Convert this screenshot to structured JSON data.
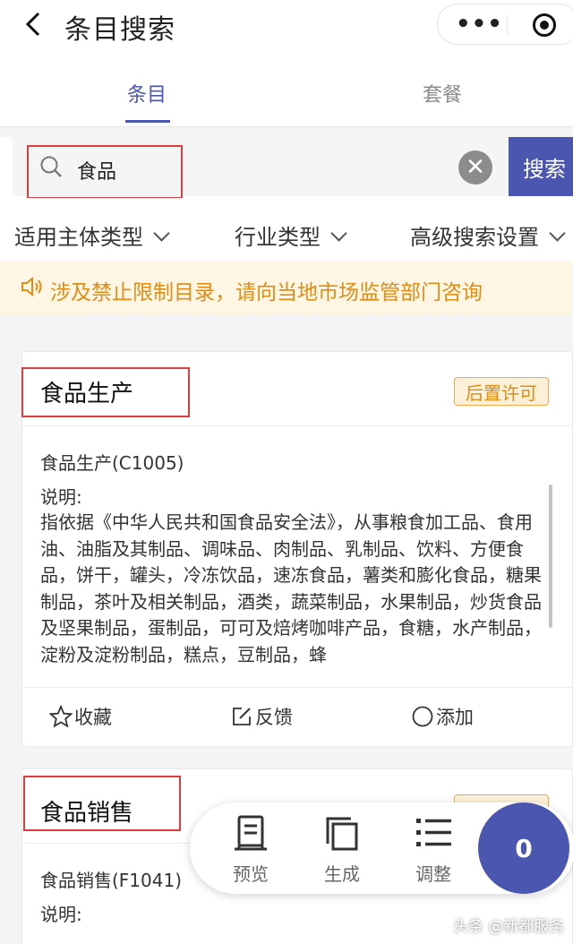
{
  "header": {
    "back_icon": "chevron-left-icon",
    "title": "条目搜索",
    "menu_icon": "more-dots-icon",
    "close_icon": "target-circle-icon"
  },
  "tabs": [
    {
      "label": "条目",
      "active": true
    },
    {
      "label": "套餐",
      "active": false
    }
  ],
  "search": {
    "icon": "search-icon",
    "value": "食品",
    "clear_icon": "clear-x-icon",
    "button_label": "搜索"
  },
  "filters": [
    {
      "label": "适用主体类型"
    },
    {
      "label": "行业类型"
    },
    {
      "label": "高级搜索设置"
    }
  ],
  "notice": {
    "icon": "speaker-icon",
    "text": "涉及禁止限制目录，请向当地市场监管部门咨询"
  },
  "cards": [
    {
      "title": "食品生产",
      "badge": "后置许可",
      "code": "食品生产(C1005)",
      "desc_label": "说明:",
      "description": "指依据《中华人民共和国食品安全法》，从事粮食加工品、食用油、油脂及其制品、调味品、肉制品、乳制品、饮料、方便食品，饼干，罐头，冷冻饮品，速冻食品，薯类和膨化食品，糖果制品，茶叶及相关制品，酒类，蔬菜制品，水果制品，炒货食品及坚果制品，蛋制品，可可及焙烤咖啡产品，食糖，水产制品，淀粉及淀粉制品，糕点，豆制品，蜂",
      "actions": [
        {
          "label": "收藏",
          "icon": "star-icon"
        },
        {
          "label": "反馈",
          "icon": "edit-icon"
        },
        {
          "label": "添加",
          "icon": "circle-icon"
        }
      ]
    },
    {
      "title": "食品销售",
      "code": "食品销售(F1041)",
      "desc_label": "说明:"
    }
  ],
  "toolbar": {
    "items": [
      {
        "label": "预览",
        "icon": "preview-icon"
      },
      {
        "label": "生成",
        "icon": "copy-icon"
      },
      {
        "label": "调整",
        "icon": "list-icon"
      }
    ],
    "count": "0"
  },
  "watermark": "头条 @新都服务",
  "colors": {
    "accent": "#4a56b0",
    "notice_text": "#e08d14",
    "notice_bg": "#fdf6e4",
    "annotation_red": "#e23b3b"
  }
}
